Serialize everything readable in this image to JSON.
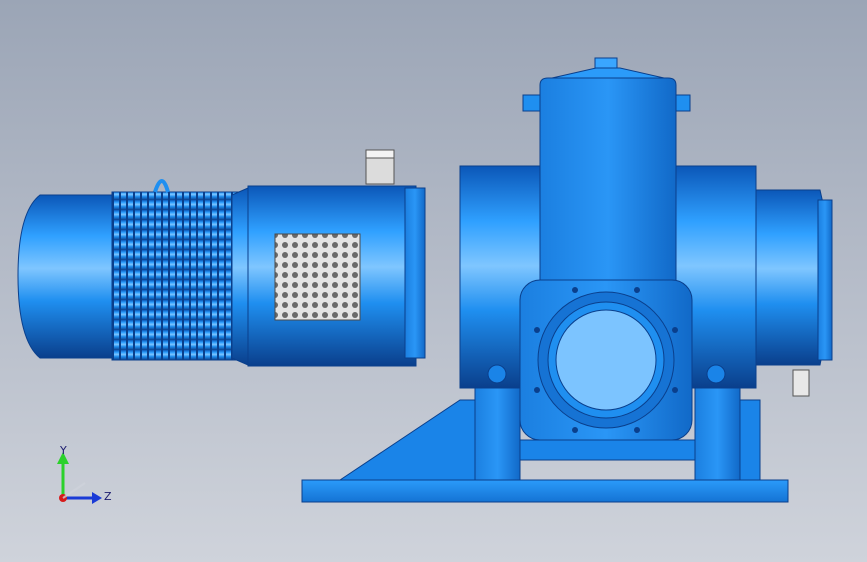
{
  "viewport": {
    "background_top": "#9ba5b6",
    "background_bottom": "#cfd3db"
  },
  "model": {
    "description_icon": "pump-assembly",
    "body_color": "#1f8ff0",
    "body_dark": "#0a4fa8",
    "body_light": "#7cc4ff",
    "grille_color": "#d9d9d9"
  },
  "triad": {
    "y_label": "Y",
    "z_label": "Z",
    "y_color": "#2bd12b",
    "z_color": "#1a3bd6",
    "x_color": "#d61a1a"
  }
}
